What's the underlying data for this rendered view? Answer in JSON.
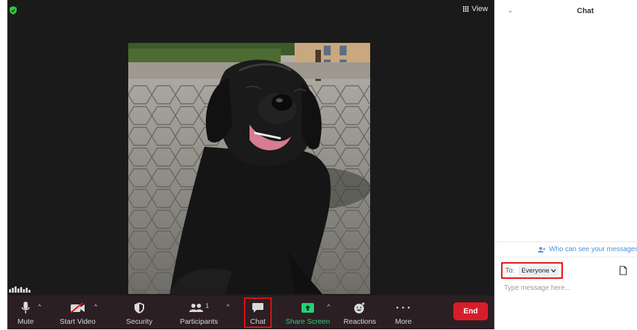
{
  "meeting": {
    "view_label": "View"
  },
  "toolbar": {
    "mute_label": "Mute",
    "start_video_label": "Start Video",
    "security_label": "Security",
    "participants_label": "Participants",
    "participants_count": "1",
    "chat_label": "Chat",
    "share_screen_label": "Share Screen",
    "reactions_label": "Reactions",
    "more_label": "More",
    "end_label": "End",
    "more_dots": "• • •"
  },
  "chat": {
    "title": "Chat",
    "who_can_see": "Who can see your messages?",
    "to_label": "To:",
    "recipient": "Everyone",
    "message_placeholder": "Type message here..."
  },
  "colors": {
    "toolbar_bg": "#2b1f23",
    "share_green": "#26d07c",
    "end_red": "#d71d2b",
    "highlight_red": "#e01010",
    "link_blue": "#4a90d9"
  }
}
